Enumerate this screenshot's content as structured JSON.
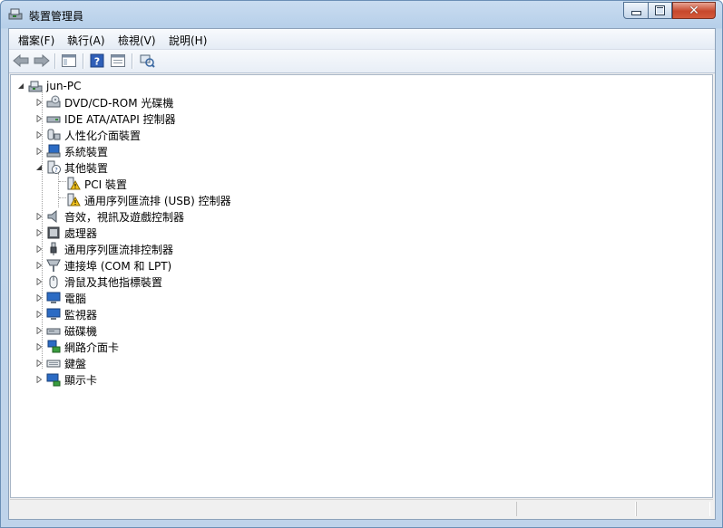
{
  "window": {
    "title": "裝置管理員"
  },
  "menu": [
    "檔案(F)",
    "執行(A)",
    "檢視(V)",
    "說明(H)"
  ],
  "toolbar": {
    "back": "back-arrow-icon",
    "forward": "forward-arrow-icon",
    "show_hide": "console-tree-icon",
    "help": "help-icon",
    "properties": "properties-icon",
    "scan": "scan-hardware-icon"
  },
  "tree": {
    "root": "jun-PC",
    "items": [
      "DVD/CD-ROM 光碟機",
      "IDE ATA/ATAPI 控制器",
      "人性化介面裝置",
      "系統裝置",
      "其他裝置",
      "PCI 裝置",
      "通用序列匯流排 (USB) 控制器",
      "音效，視訊及遊戲控制器",
      "處理器",
      "通用序列匯流排控制器",
      "連接埠 (COM 和 LPT)",
      "滑鼠及其他指標裝置",
      "電腦",
      "監視器",
      "磁碟機",
      "網路介面卡",
      "鍵盤",
      "顯示卡"
    ]
  },
  "colors": {
    "accent": "#c7472c",
    "warning": "#f2c21b"
  }
}
